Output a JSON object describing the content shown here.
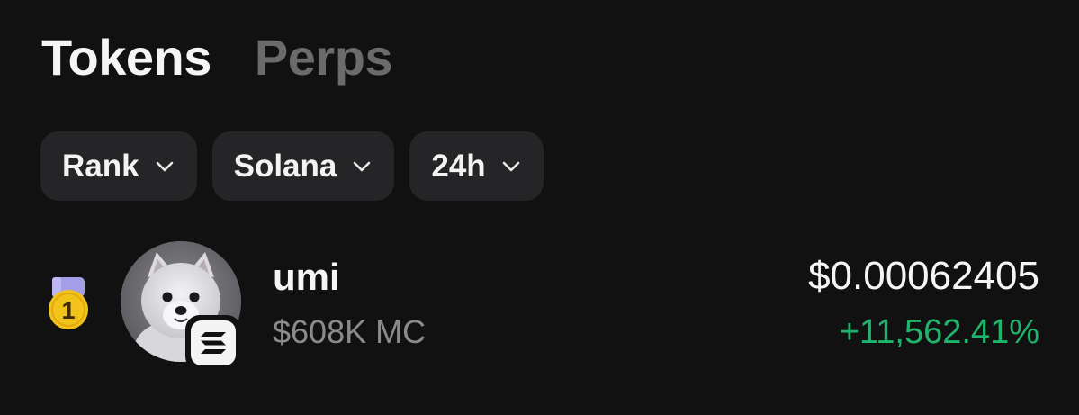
{
  "tabs": [
    {
      "label": "Tokens",
      "active": true
    },
    {
      "label": "Perps",
      "active": false
    }
  ],
  "filters": [
    {
      "label": "Rank",
      "icon": "chevron-down-icon"
    },
    {
      "label": "Solana",
      "icon": "chevron-down-icon"
    },
    {
      "label": "24h",
      "icon": "chevron-down-icon"
    }
  ],
  "tokens": [
    {
      "rank": "1",
      "rank_icon": "gold-medal-icon",
      "name": "umi",
      "market_cap": "$608K MC",
      "price": "$0.00062405",
      "change": "+11,562.41%",
      "avatar": "dog-avatar",
      "chain_icon": "solana-icon"
    }
  ],
  "colors": {
    "background": "#111112",
    "chip_bg": "#252527",
    "positive": "#1fb36b",
    "muted": "#8b8b8e",
    "inactive_tab": "#6b6b6d",
    "medal_gold": "#f2c31a",
    "medal_ribbon": "#a49ee8"
  }
}
